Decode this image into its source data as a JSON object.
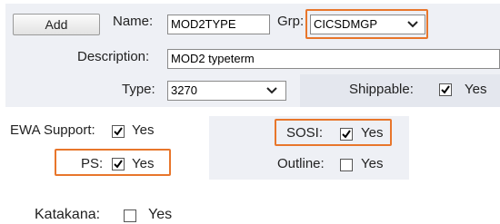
{
  "toolbar": {
    "add_label": "Add"
  },
  "form": {
    "name_label": "Name:",
    "name_value": "MOD2TYPE",
    "grp_label": "Grp:",
    "grp_value": "CICSDMGP",
    "description_label": "Description:",
    "description_value": "MOD2 typeterm",
    "type_label": "Type:",
    "type_value": "3270",
    "shippable_label": "Shippable:",
    "shippable_checked": true,
    "shippable_yes": "Yes"
  },
  "options": {
    "ewa_label": "EWA Support:",
    "ewa_checked": true,
    "ewa_yes": "Yes",
    "ps_label": "PS:",
    "ps_checked": true,
    "ps_yes": "Yes",
    "sosi_label": "SOSI:",
    "sosi_checked": true,
    "sosi_yes": "Yes",
    "outline_label": "Outline:",
    "outline_checked": false,
    "outline_yes": "Yes",
    "katakana_label": "Katakana:",
    "katakana_checked": false,
    "katakana_yes": "Yes"
  },
  "colors": {
    "panel": "#eef0f5",
    "highlight": "#e8762b"
  },
  "icons": {
    "dropdown": "chevron-down-icon",
    "check": "checkmark-icon"
  }
}
